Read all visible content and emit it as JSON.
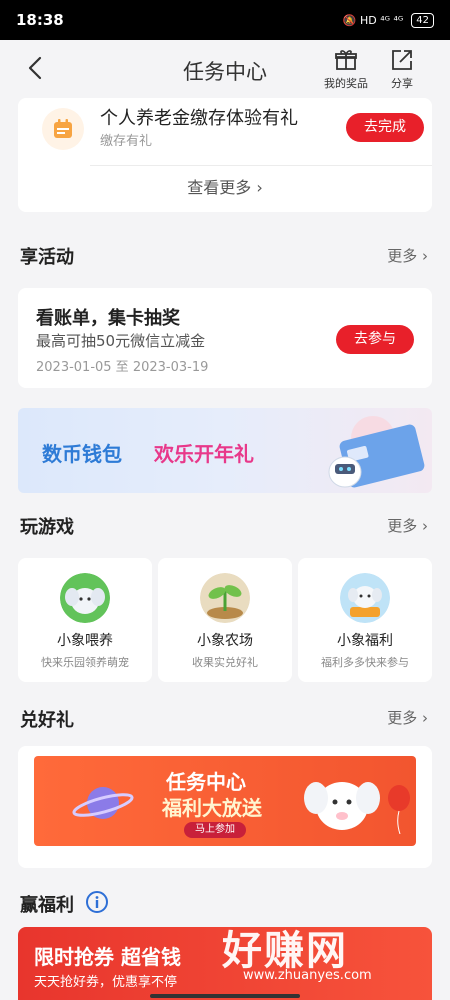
{
  "status_bar": {
    "time": "18:38",
    "indicators": "🔕 HD ⁴ᴳ ⁴ᴳ",
    "battery": "42"
  },
  "header": {
    "title": "任务中心",
    "my_prizes_label": "我的奖品",
    "share_label": "分享"
  },
  "task": {
    "title": "个人养老金缴存体验有礼",
    "subtitle": "缴存有礼",
    "button_label": "去完成",
    "see_more_label": "查看更多"
  },
  "activities": {
    "section_title": "享活动",
    "more_label": "更多",
    "item": {
      "title": "看账单，集卡抽奖",
      "subtitle": "最高可抽50元微信立减金",
      "date_range": "2023-01-05 至 2023-03-19",
      "button_label": "去参与"
    },
    "banner": {
      "text_blue": "数币钱包",
      "text_pink": "欢乐开年礼"
    }
  },
  "games": {
    "section_title": "玩游戏",
    "more_label": "更多",
    "items": [
      {
        "name": "小象喂养",
        "desc": "快来乐园领养萌宠"
      },
      {
        "name": "小象农场",
        "desc": "收果实兑好礼"
      },
      {
        "name": "小象福利",
        "desc": "福利多多快来参与"
      }
    ]
  },
  "gifts": {
    "section_title": "兑好礼",
    "more_label": "更多",
    "banner": {
      "line1": "任务中心",
      "line2": "福利大放送",
      "button_label": "马上参加"
    }
  },
  "welfare": {
    "section_title": "赢福利",
    "banner": {
      "title": "限时抢券 超省钱",
      "subtitle": "天天抢好券，优惠享不停"
    }
  },
  "watermark": {
    "text": "好赚网",
    "url": "www.zhuanyes.com"
  },
  "colors": {
    "accent_red": "#e8202a",
    "blue": "#2e7bd6",
    "pink": "#e8388a",
    "orange": "#ff6a3a"
  }
}
